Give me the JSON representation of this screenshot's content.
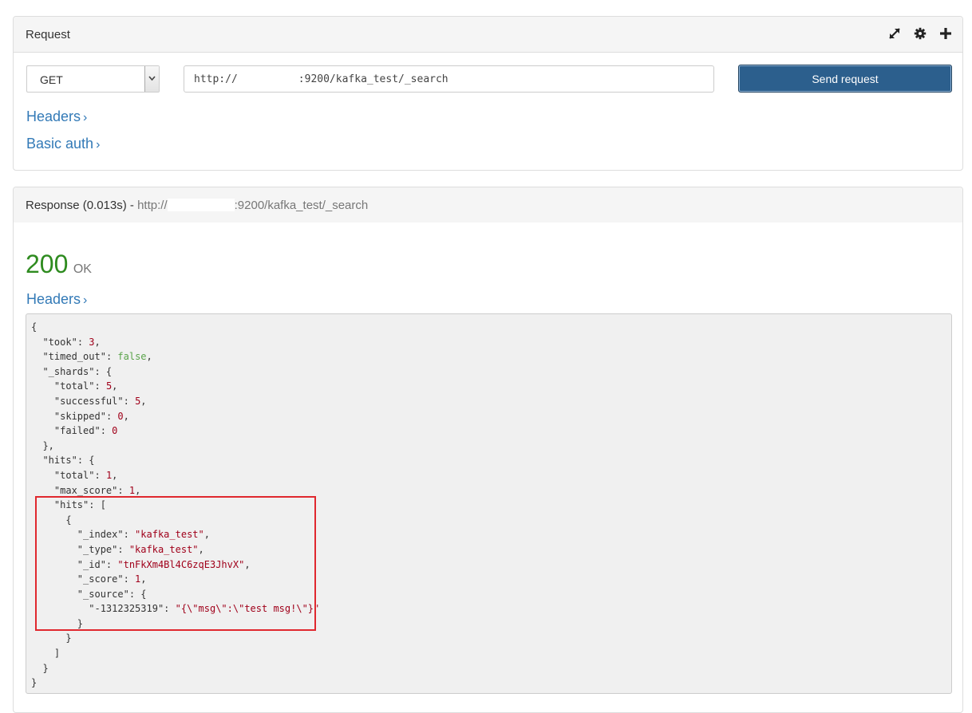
{
  "request": {
    "title": "Request",
    "method": "GET",
    "url_prefix": "http://",
    "url_suffix": ":9200/kafka_test/_search",
    "send_label": "Send request",
    "headers_label": "Headers",
    "basic_auth_label": "Basic auth"
  },
  "response": {
    "title": "Response (0.013s)",
    "separator": " - ",
    "url_prefix": "http://",
    "url_suffix": ":9200/kafka_test/_search",
    "status_code": "200",
    "status_text": "OK",
    "headers_label": "Headers"
  },
  "json": {
    "took": "3",
    "timed_out": "false",
    "shards_total": "5",
    "shards_successful": "5",
    "shards_skipped": "0",
    "shards_failed": "0",
    "hits_total": "1",
    "max_score": "1",
    "index": "\"kafka_test\"",
    "type": "\"kafka_test\"",
    "id": "\"tnFkXm4Bl4C6zqE3JhvX\"",
    "score": "1",
    "source_key": "\"-1312325319\"",
    "source_value": "\"{\\\"msg\\\":\\\"test msg!\\\"}\""
  },
  "colors": {
    "accent": "#337ab7",
    "button": "#2c5f8d",
    "status_ok": "#2e8b1f",
    "highlight": "#e0282e"
  },
  "icons": [
    "expand-icon",
    "gear-icon",
    "plus-icon",
    "chevron-right-icon",
    "caret-down-icon"
  ]
}
